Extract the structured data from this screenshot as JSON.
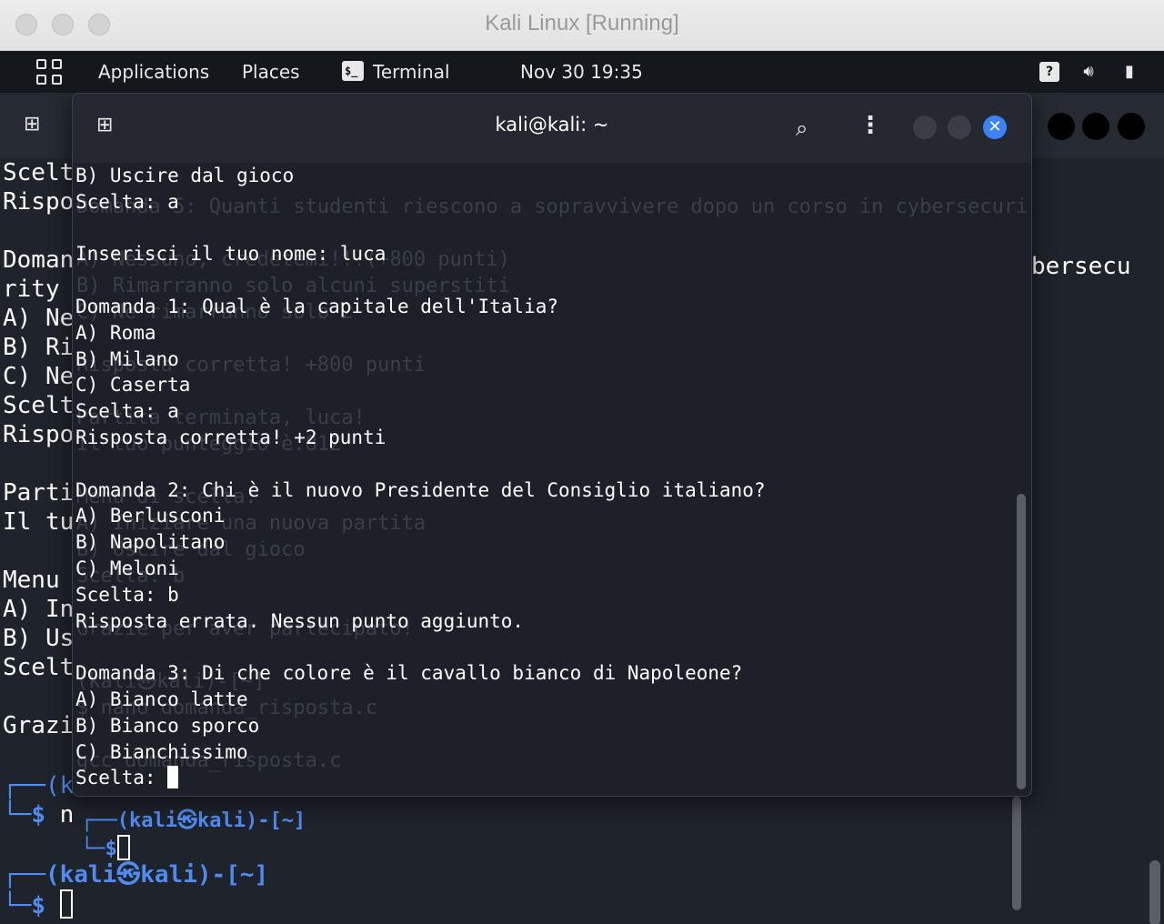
{
  "window": {
    "title": "Kali Linux [Running]"
  },
  "panel": {
    "applications": "Applications",
    "places": "Places",
    "terminal": "Terminal",
    "clock": "Nov 30  19:35",
    "term_icon_glyph": "$_"
  },
  "front_terminal": {
    "title": "kali@kali: ~",
    "lines": [
      "B) Uscire dal gioco",
      "Scelta: a",
      "",
      "Inserisci il tuo nome: luca",
      "",
      "Domanda 1: Qual è la capitale dell'Italia?",
      "A) Roma",
      "B) Milano",
      "C) Caserta",
      "Scelta: a",
      "Risposta corretta! +2 punti",
      "",
      "Domanda 2: Chi è il nuovo Presidente del Consiglio italiano?",
      "A) Berlusconi",
      "B) Napolitano",
      "C) Meloni",
      "Scelta: b",
      "Risposta errata. Nessun punto aggiunto.",
      "",
      "Domanda 3: Di che colore è il cavallo bianco di Napoleone?",
      "A) Bianco latte",
      "B) Bianco sporco",
      "C) Bianchissimo"
    ],
    "input_prompt": "Scelta: "
  },
  "back_terminal": {
    "left_lines": [
      "Scelt",
      "Rispo",
      "",
      "Doman",
      "rity",
      "A) Ne",
      "B) Ri",
      "C) Ne",
      "Scelt",
      "Rispo",
      "",
      "Parti",
      "Il tu",
      "",
      "Menu",
      "A) In",
      "B) Us",
      "Scelt",
      "",
      "Grazi"
    ],
    "right_fragment": "bersecu",
    "prompt_user": "(kali㉿kali)-[~]",
    "prompt_symbol": "$",
    "partial_user": "(k",
    "partial_cmd": "n"
  },
  "middle_terminal": {
    "prompt_user": "(kali㉿kali)-[~]",
    "prompt_symbol": "$"
  },
  "ghost_lines": [
    "Domanda 5: Quanti studenti riescono a sopravvivere dopo un corso in cybersecuri",
    "",
    "A) Nessuno, credetemi!!!(+800 punti)",
    "B) Rimarranno solo alcuni superstiti",
    "C) Ne rimarranno solo 2",
    "",
    "Risposta corretta! +800 punti",
    "",
    "Partita terminata, luca!",
    "Il tuo punteggio è:812",
    "",
    "Menu di scelta:",
    "A) Iniziare una nuova partita",
    "B) Uscire dal gioco",
    "Scelta: b",
    "",
    "Grazie per aver partecipato!",
    "",
    "(kali㉿kali)-[~]",
    "$ nano domanda_risposta.c",
    "",
    "gcc domanda_risposta.c"
  ]
}
